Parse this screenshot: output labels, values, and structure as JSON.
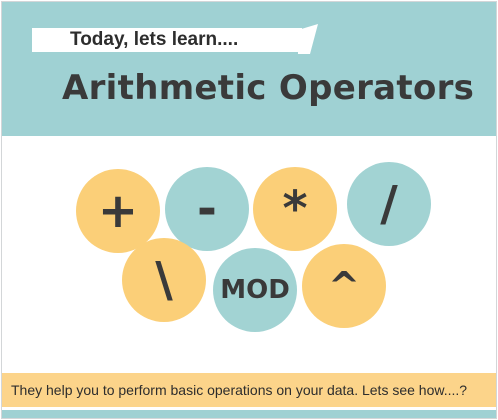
{
  "header": {
    "subtitle": "Today, lets learn....",
    "title": "Arithmetic Operators"
  },
  "operators": [
    {
      "symbol": "+",
      "color": "#fbcf78"
    },
    {
      "symbol": "-",
      "color": "#a2d3d3"
    },
    {
      "symbol": "*",
      "color": "#fbcf78"
    },
    {
      "symbol": "/",
      "color": "#a2d3d3"
    },
    {
      "symbol": "\\",
      "color": "#fbcf78"
    },
    {
      "symbol": "MOD",
      "color": "#a2d3d3"
    },
    {
      "symbol": "^",
      "color": "#fbcf78"
    }
  ],
  "footer": {
    "text": "They help you to perform basic operations on your data. Lets see how....?"
  },
  "colors": {
    "banner": "#9fd1d3",
    "orange": "#fbcf78",
    "teal": "#a2d3d3",
    "footer_band": "#fcd48a",
    "text": "#3a3a3a"
  }
}
